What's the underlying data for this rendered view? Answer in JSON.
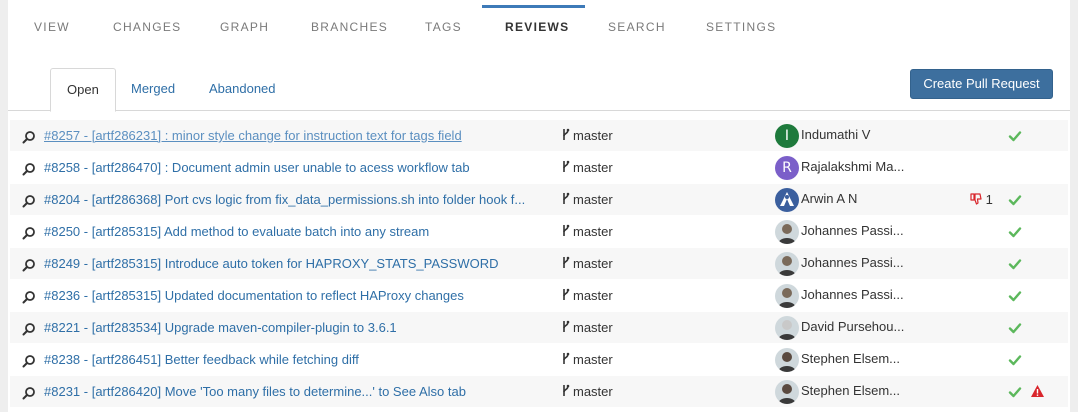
{
  "nav": {
    "items": [
      "VIEW",
      "CHANGES",
      "GRAPH",
      "BRANCHES",
      "TAGS",
      "REVIEWS",
      "SEARCH",
      "SETTINGS"
    ],
    "active": "REVIEWS"
  },
  "subtabs": {
    "items": [
      "Open",
      "Merged",
      "Abandoned"
    ],
    "active": "Open"
  },
  "create_button": "Create Pull Request",
  "colors": {
    "accent": "#3d6f9e",
    "link": "#2f6fa7",
    "approve": "#5cb85c",
    "reject": "#d9262c"
  },
  "reviews": [
    {
      "title": "#8257 - [artf286231] : minor style change for instruction text for tags field",
      "branch": "master",
      "author": "Indumathi V",
      "avatar": {
        "type": "letter",
        "letter": "I",
        "color": "#1e7a3c"
      },
      "approved": true,
      "vote": "",
      "warning": false
    },
    {
      "title": "#8258 - [artf286470] : Document admin user unable to acess workflow tab",
      "branch": "master",
      "author": "Rajalakshmi Ma...",
      "avatar": {
        "type": "letter",
        "letter": "R",
        "color": "#7b5fc9"
      },
      "approved": false,
      "vote": "",
      "warning": false
    },
    {
      "title": "#8204 - [artf286368] Port cvs logic from fix_data_permissions.sh into folder hook f...",
      "branch": "master",
      "author": "Arwin A N",
      "avatar": {
        "type": "logo",
        "color": "#3b5f9e"
      },
      "approved": true,
      "vote": "1",
      "warning": false
    },
    {
      "title": "#8250 - [artf285315] Add method to evaluate batch into any stream",
      "branch": "master",
      "author": "Johannes Passi...",
      "avatar": {
        "type": "photo",
        "color": "#7a6a5a"
      },
      "approved": true,
      "vote": "",
      "warning": false
    },
    {
      "title": "#8249 - [artf285315] Introduce auto token for HAPROXY_STATS_PASSWORD",
      "branch": "master",
      "author": "Johannes Passi...",
      "avatar": {
        "type": "photo",
        "color": "#7a6a5a"
      },
      "approved": true,
      "vote": "",
      "warning": false
    },
    {
      "title": "#8236 - [artf285315] Updated documentation to reflect HAProxy changes",
      "branch": "master",
      "author": "Johannes Passi...",
      "avatar": {
        "type": "photo",
        "color": "#7a6a5a"
      },
      "approved": true,
      "vote": "",
      "warning": false
    },
    {
      "title": "#8221 - [artf283534] Upgrade maven-compiler-plugin to 3.6.1",
      "branch": "master",
      "author": "David Pursehou...",
      "avatar": {
        "type": "photo",
        "color": "#c9c9c9"
      },
      "approved": true,
      "vote": "",
      "warning": false
    },
    {
      "title": "#8238 - [artf286451] Better feedback while fetching diff",
      "branch": "master",
      "author": "Stephen Elsem...",
      "avatar": {
        "type": "photo",
        "color": "#5a4a40"
      },
      "approved": true,
      "vote": "",
      "warning": false
    },
    {
      "title": "#8231 - [artf286420] Move 'Too many files to determine...' to See Also tab",
      "branch": "master",
      "author": "Stephen Elsem...",
      "avatar": {
        "type": "photo",
        "color": "#5a4a40"
      },
      "approved": true,
      "vote": "",
      "warning": true
    }
  ]
}
